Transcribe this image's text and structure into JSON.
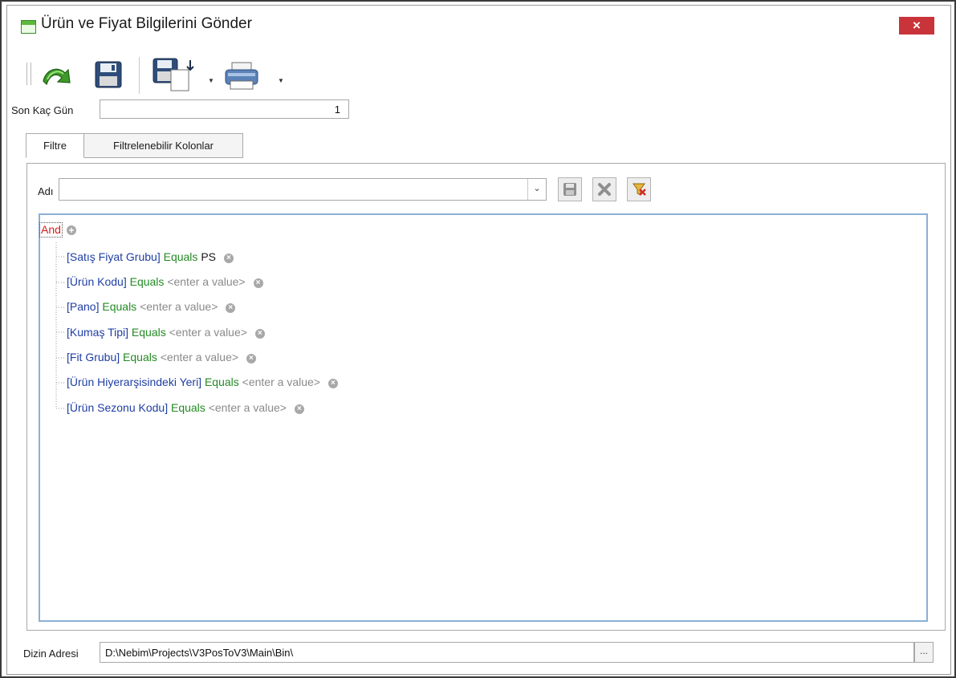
{
  "window": {
    "title": "Ürün ve Fiyat Bilgilerini Gönder",
    "close_label": "×"
  },
  "toolbar": {
    "icons": [
      "refresh-arrow-icon",
      "save-icon",
      "save-layout-icon",
      "print-icon"
    ]
  },
  "form": {
    "days_label": "Son Kaç Gün",
    "days_value": "1",
    "directory_label": "Dizin Adresi",
    "directory_value": "D:\\Nebim\\Projects\\V3PosToV3\\Main\\Bin\\",
    "browse_label": "..."
  },
  "tabs": [
    {
      "label": "Filtre",
      "active": true
    },
    {
      "label": "Filtrelenebilir Kolonlar",
      "active": false
    }
  ],
  "filter": {
    "name_label": "Adı",
    "name_value": "",
    "group_operator": "And",
    "conditions": [
      {
        "field": "[Satış Fiyat Grubu]",
        "operator": "Equals",
        "value": "PS",
        "placeholder": false
      },
      {
        "field": "[Ürün Kodu]",
        "operator": "Equals",
        "value": "<enter a value>",
        "placeholder": true
      },
      {
        "field": "[Pano]",
        "operator": "Equals",
        "value": "<enter a value>",
        "placeholder": true
      },
      {
        "field": "[Kumaş Tipi]",
        "operator": "Equals",
        "value": "<enter a value>",
        "placeholder": true
      },
      {
        "field": "[Fit Grubu]",
        "operator": "Equals",
        "value": "<enter a value>",
        "placeholder": true
      },
      {
        "field": "[Ürün Hiyerarşisindeki Yeri]",
        "operator": "Equals",
        "value": "<enter a value>",
        "placeholder": true
      },
      {
        "field": "[Ürün Sezonu Kodu]",
        "operator": "Equals",
        "value": "<enter a value>",
        "placeholder": true
      }
    ]
  },
  "colors": {
    "close": "#c8343a",
    "field": "#1f3ea3",
    "operator": "#248a24",
    "group_operator": "#d61c1c",
    "filter_border": "#8bb0d6"
  }
}
